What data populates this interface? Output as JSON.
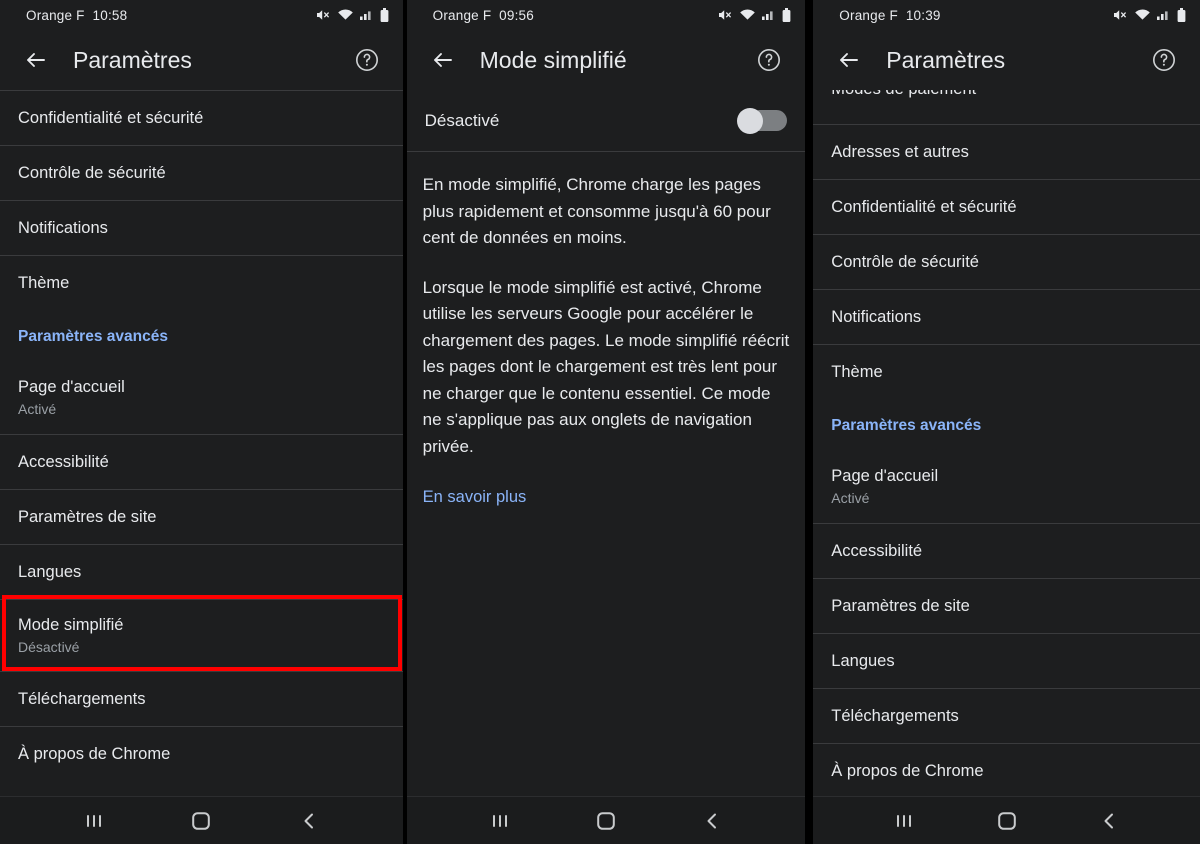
{
  "panels": [
    {
      "statusbar": {
        "carrier": "Orange F  10:58",
        "icons": [
          "mute-icon",
          "wifi-icon",
          "signal-icon",
          "battery-icon"
        ]
      },
      "header": {
        "back": "back-arrow-icon",
        "title": "Paramètres",
        "help": "help-circle-icon"
      },
      "items": [
        {
          "type": "item",
          "title": "Confidentialité et sécurité"
        },
        {
          "type": "item",
          "title": "Contrôle de sécurité"
        },
        {
          "type": "item",
          "title": "Notifications"
        },
        {
          "type": "item",
          "title": "Thème"
        },
        {
          "type": "section",
          "title": "Paramètres avancés"
        },
        {
          "type": "two-line",
          "title": "Page d'accueil",
          "sub": "Activé"
        },
        {
          "type": "item",
          "title": "Accessibilité"
        },
        {
          "type": "item",
          "title": "Paramètres de site"
        },
        {
          "type": "item",
          "title": "Langues"
        },
        {
          "type": "two-line",
          "title": "Mode simplifié",
          "sub": "Désactivé",
          "highlight": true
        },
        {
          "type": "item",
          "title": "Téléchargements"
        },
        {
          "type": "item",
          "title": "À propos de Chrome"
        }
      ],
      "navbar": [
        "recents-button",
        "home-button",
        "back-button"
      ]
    },
    {
      "statusbar": {
        "carrier": "Orange F  09:56"
      },
      "header": {
        "title": "Mode simplifié"
      },
      "toggle": {
        "label": "Désactivé",
        "state": "off"
      },
      "paragraphs": [
        "En mode simplifié, Chrome charge les pages plus rapidement et consomme jusqu'à 60 pour cent de données en moins.",
        "Lorsque le mode simplifié est activé, Chrome utilise les serveurs Google pour accélérer le chargement des pages. Le mode simplifié réécrit les pages dont le chargement est très lent pour ne charger que le contenu essentiel. Ce mode ne s'applique pas aux onglets de navigation privée."
      ],
      "link": "En savoir plus"
    },
    {
      "statusbar": {
        "carrier": "Orange F  10:39"
      },
      "header": {
        "title": "Paramètres"
      },
      "clipped_item": "Modes de paiement",
      "items": [
        {
          "type": "item",
          "title": "Adresses et autres"
        },
        {
          "type": "item",
          "title": "Confidentialité et sécurité"
        },
        {
          "type": "item",
          "title": "Contrôle de sécurité"
        },
        {
          "type": "item",
          "title": "Notifications"
        },
        {
          "type": "item",
          "title": "Thème"
        },
        {
          "type": "section",
          "title": "Paramètres avancés"
        },
        {
          "type": "two-line",
          "title": "Page d'accueil",
          "sub": "Activé"
        },
        {
          "type": "item",
          "title": "Accessibilité"
        },
        {
          "type": "item",
          "title": "Paramètres de site"
        },
        {
          "type": "item",
          "title": "Langues"
        },
        {
          "type": "item",
          "title": "Téléchargements"
        },
        {
          "type": "item",
          "title": "À propos de Chrome"
        }
      ]
    }
  ],
  "colors": {
    "background": "#1d1e1f",
    "text_primary": "#e8eaed",
    "text_secondary": "#9aa0a6",
    "accent_blue": "#8ab4f8",
    "divider": "#3a3b3d",
    "highlight_red": "#ff0000",
    "navbar": "#1b1c1d"
  }
}
